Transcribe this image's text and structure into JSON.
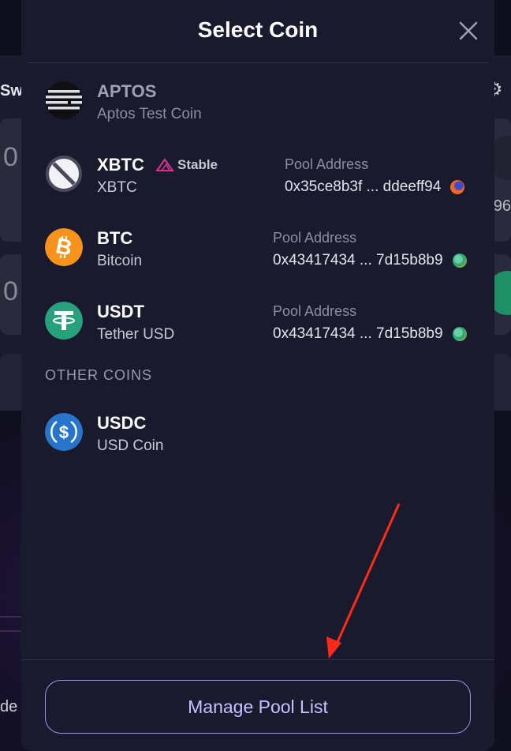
{
  "background": {
    "swap_label": "Sw",
    "zero_1": "0",
    "zero_2": "0",
    "side_number": "96",
    "bottom_text": "de I"
  },
  "modal": {
    "title": "Select Coin",
    "close_icon": "close-icon",
    "coins": [
      {
        "symbol": "APTOS",
        "name": "Aptos Test Coin",
        "icon": "aptos-icon",
        "dimmed": true
      },
      {
        "symbol": "XBTC",
        "name": "XBTC",
        "icon": "blocked-icon",
        "tag": "Stable",
        "tag_icon": "stable-triangle-icon",
        "pool_label": "Pool Address",
        "pool_address": "0x35ce8b3f ... ddeeff94",
        "pool_icon_color": "#f26522"
      },
      {
        "symbol": "BTC",
        "name": "Bitcoin",
        "icon": "bitcoin-icon",
        "pool_label": "Pool Address",
        "pool_address": "0x43417434 ... 7d15b8b9",
        "pool_icon_color": "#1aa67a"
      },
      {
        "symbol": "USDT",
        "name": "Tether USD",
        "icon": "tether-icon",
        "pool_label": "Pool Address",
        "pool_address": "0x43417434 ... 7d15b8b9",
        "pool_icon_color": "#1aa67a"
      }
    ],
    "other_section_label": "OTHER COINS",
    "other_coins": [
      {
        "symbol": "USDC",
        "name": "USD Coin",
        "icon": "usdc-icon"
      }
    ],
    "manage_button_label": "Manage Pool List"
  },
  "colors": {
    "modal_bg": "#1a1a2e",
    "accent_border": "#9d93e6",
    "accent_text": "#c9c1ff",
    "bitcoin": "#f7931a",
    "tether": "#26a17b",
    "usdc": "#2775ca",
    "stable_tag": "#d6338f",
    "annotation_arrow": "#ff2a1a"
  }
}
